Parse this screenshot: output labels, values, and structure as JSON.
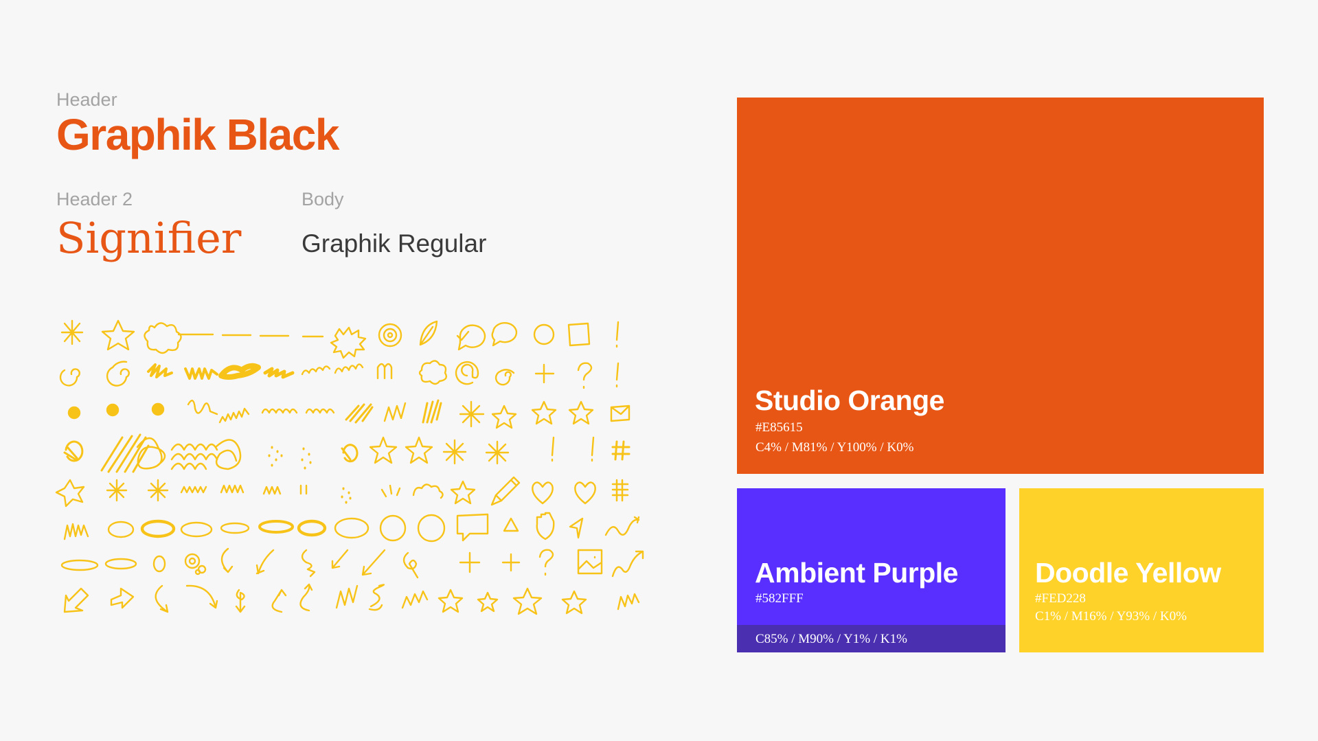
{
  "typography": {
    "header": {
      "label": "Header",
      "sample": "Graphik Black"
    },
    "header2": {
      "label": "Header 2",
      "sample": "Signifier"
    },
    "body": {
      "label": "Body",
      "sample": "Graphik Regular"
    }
  },
  "doodles": {
    "color": "#f8c318"
  },
  "swatches": [
    {
      "name": "Studio Orange",
      "hex": "#E85615",
      "cmyk": "C4% / M81% / Y100% / K0%",
      "color": "#e85615"
    },
    {
      "name": "Ambient Purple",
      "hex": "#582FFF",
      "cmyk": "C85% / M90% / Y1% / K1%",
      "color": "#582fff",
      "band_color": "#4a2fb0"
    },
    {
      "name": "Doodle Yellow",
      "hex": "#FED228",
      "cmyk": "C1% / M16% / Y93% / K0%",
      "color": "#fed228"
    }
  ]
}
